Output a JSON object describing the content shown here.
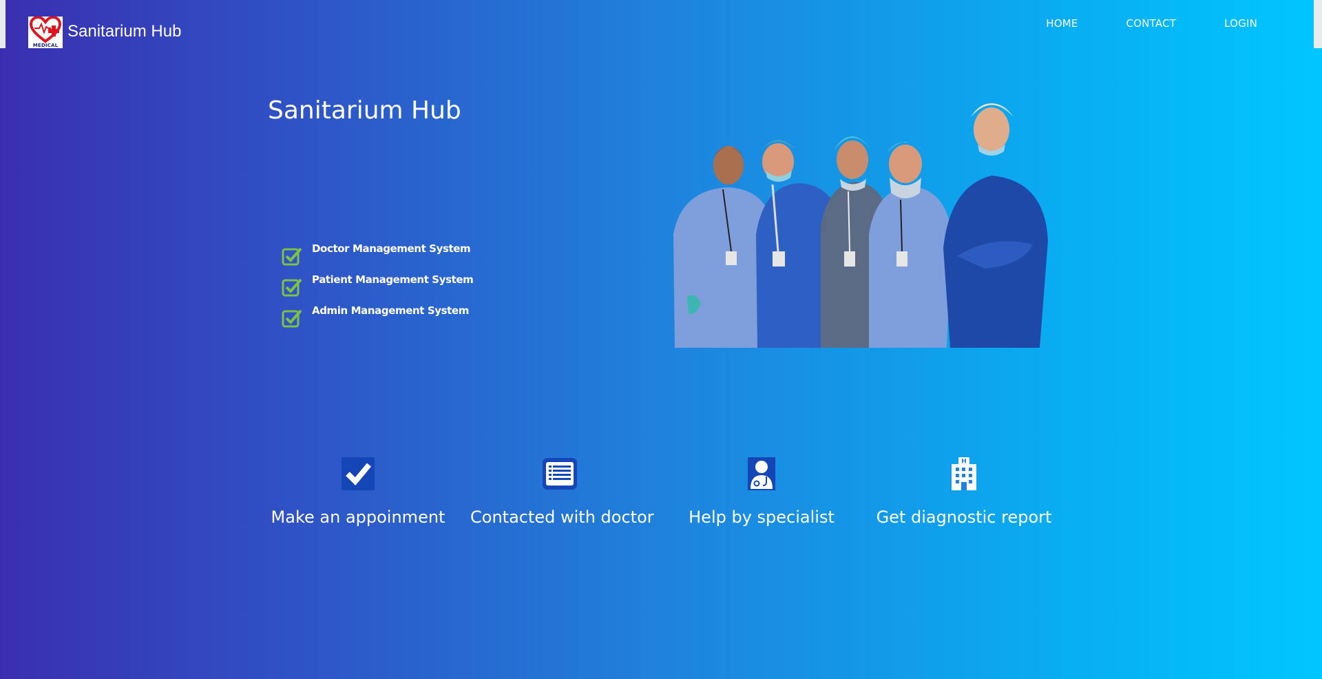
{
  "brand": {
    "name": "Sanitarium Hub",
    "logo_text": "MEDICAL",
    "logo_icon": "heart-cross-icon"
  },
  "nav": {
    "items": [
      {
        "label": "HOME"
      },
      {
        "label": "CONTACT"
      },
      {
        "label": "LOGIN"
      }
    ]
  },
  "hero": {
    "title": "Sanitarium Hub",
    "features": [
      {
        "label": "Doctor Management System",
        "icon": "check-icon"
      },
      {
        "label": "Patient Management System",
        "icon": "check-icon"
      },
      {
        "label": "Admin Management System",
        "icon": "check-icon"
      }
    ],
    "image": "medical-team-photo"
  },
  "services": [
    {
      "label": "Make an appoinment",
      "icon": "checkbox-icon"
    },
    {
      "label": "Contacted with doctor",
      "icon": "list-icon"
    },
    {
      "label": "Help by specialist",
      "icon": "doctor-icon"
    },
    {
      "label": "Get diagnostic report",
      "icon": "hospital-icon"
    }
  ],
  "colors": {
    "gradient_start": "#3a2fb0",
    "gradient_end": "#00c6ff",
    "check_green": "#7dc242",
    "icon_dark_blue": "#1546b8"
  }
}
